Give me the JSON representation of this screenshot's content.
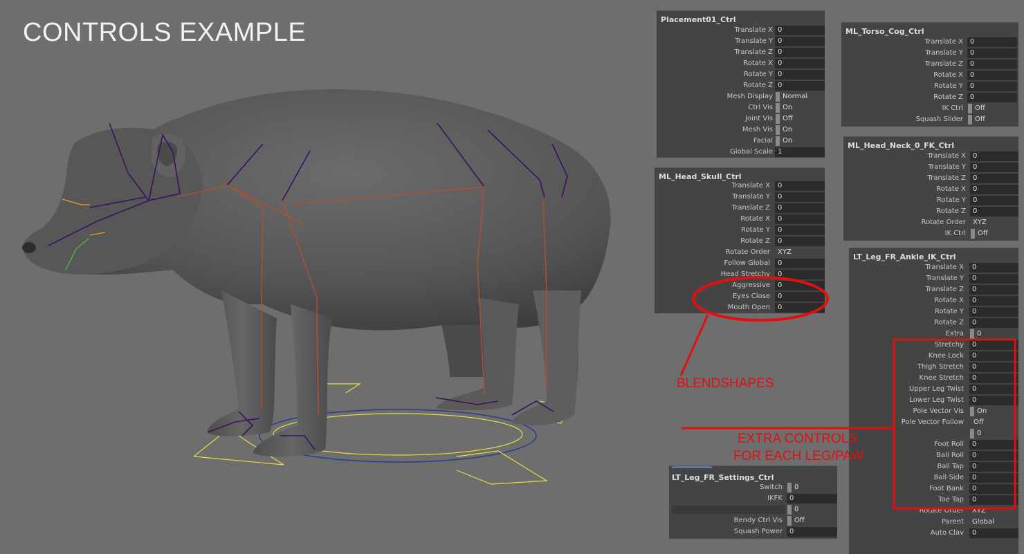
{
  "title": "CONTROLS EXAMPLE",
  "panels": {
    "placement": {
      "title": "Placement01_Ctrl",
      "rows": [
        {
          "label": "Translate X",
          "value": "0"
        },
        {
          "label": "Translate Y",
          "value": "0"
        },
        {
          "label": "Translate Z",
          "value": "0"
        },
        {
          "label": "Rotate X",
          "value": "0"
        },
        {
          "label": "Rotate Y",
          "value": "0"
        },
        {
          "label": "Rotate Z",
          "value": "0"
        },
        {
          "label": "Mesh Display",
          "value": "Normal"
        },
        {
          "label": "Ctrl Vis",
          "value": "On"
        },
        {
          "label": "Joint Vis",
          "value": "Off"
        },
        {
          "label": "Mesh Vis",
          "value": "On"
        },
        {
          "label": "Facial",
          "value": "On"
        },
        {
          "label": "Global Scale",
          "value": "1"
        }
      ]
    },
    "head_skull": {
      "title": "ML_Head_Skull_Ctrl",
      "rows": [
        {
          "label": "Translate X",
          "value": "0"
        },
        {
          "label": "Translate Y",
          "value": "0"
        },
        {
          "label": "Translate Z",
          "value": "0"
        },
        {
          "label": "Rotate X",
          "value": "0"
        },
        {
          "label": "Rotate Y",
          "value": "0"
        },
        {
          "label": "Rotate Z",
          "value": "0"
        },
        {
          "label": "Rotate Order",
          "value": "XYZ"
        },
        {
          "label": "Follow Global",
          "value": "0"
        },
        {
          "label": "Head Stretchy",
          "value": "0"
        },
        {
          "label": "Aggressive",
          "value": "0"
        },
        {
          "label": "Eyes Close",
          "value": "0"
        },
        {
          "label": "Mouth Open",
          "value": "0"
        }
      ]
    },
    "torso_cog": {
      "title": "ML_Torso_Cog_Ctrl",
      "rows": [
        {
          "label": "Translate X",
          "value": "0"
        },
        {
          "label": "Translate Y",
          "value": "0"
        },
        {
          "label": "Translate Z",
          "value": "0"
        },
        {
          "label": "Rotate X",
          "value": "0"
        },
        {
          "label": "Rotate Y",
          "value": "0"
        },
        {
          "label": "Rotate Z",
          "value": "0"
        },
        {
          "label": "IK Ctrl",
          "value": "Off"
        },
        {
          "label": "Squash Slider",
          "value": "Off"
        }
      ]
    },
    "head_neck": {
      "title": "ML_Head_Neck_0_FK_Ctrl",
      "rows": [
        {
          "label": "Translate X",
          "value": "0"
        },
        {
          "label": "Translate Y",
          "value": "0"
        },
        {
          "label": "Translate Z",
          "value": "0"
        },
        {
          "label": "Rotate X",
          "value": "0"
        },
        {
          "label": "Rotate Y",
          "value": "0"
        },
        {
          "label": "Rotate Z",
          "value": "0"
        },
        {
          "label": "Rotate Order",
          "value": "XYZ"
        },
        {
          "label": "IK Ctrl",
          "value": "Off"
        }
      ]
    },
    "ankle_ik": {
      "title": "LT_Leg_FR_Ankle_IK_Ctrl",
      "rows": [
        {
          "label": "Translate X",
          "value": "0"
        },
        {
          "label": "Translate Y",
          "value": "0"
        },
        {
          "label": "Translate Z",
          "value": "0"
        },
        {
          "label": "Rotate X",
          "value": "0"
        },
        {
          "label": "Rotate Y",
          "value": "0"
        },
        {
          "label": "Rotate Z",
          "value": "0"
        },
        {
          "label": "Extra",
          "value": "0"
        },
        {
          "label": "Stretchy",
          "value": "0"
        },
        {
          "label": "Knee Lock",
          "value": "0"
        },
        {
          "label": "Thigh Stretch",
          "value": "0"
        },
        {
          "label": "Knee Stretch",
          "value": "0"
        },
        {
          "label": "Upper Leg Twist",
          "value": "0"
        },
        {
          "label": "Lower Leg Twist",
          "value": "0"
        },
        {
          "label": "Pole Vector Vis",
          "value": "On"
        },
        {
          "label": "Pole Vector Follow",
          "value": "Off"
        },
        {
          "label": "",
          "value": "0"
        },
        {
          "label": "Foot Roll",
          "value": "0"
        },
        {
          "label": "Ball Roll",
          "value": "0"
        },
        {
          "label": "Ball Tap",
          "value": "0"
        },
        {
          "label": "Ball Side",
          "value": "0"
        },
        {
          "label": "Foot Bank",
          "value": "0"
        },
        {
          "label": "Toe Tap",
          "value": "0"
        },
        {
          "label": "Rotate Order",
          "value": "XYZ"
        },
        {
          "label": "Parent",
          "value": "Global"
        },
        {
          "label": "Auto Clav",
          "value": "0"
        }
      ]
    },
    "leg_settings": {
      "title": "LT_Leg_FR_Settings_Ctrl",
      "rows": [
        {
          "label": "Switch",
          "value": "0"
        },
        {
          "label": "IKFK",
          "value": "0"
        },
        {
          "label": "",
          "value": "0"
        },
        {
          "label": "Bendy Ctrl Vis",
          "value": "Off"
        },
        {
          "label": "Squash Power",
          "value": "0"
        }
      ]
    }
  },
  "annotations": {
    "blendshapes": "BLENDSHAPES",
    "extra_line1": "EXTRA CONTROLS",
    "extra_line2": "FOR EACH LEG/PAW"
  },
  "colors": {
    "background": "#6e6e6e",
    "panel": "#444444",
    "field": "#2b2b2b",
    "annotation": "#e01010",
    "bear": "#5c5c5c",
    "joint_purple": "#3a1060",
    "joint_orange": "#b4502a",
    "ctrl_yellow": "#e8e040",
    "ctrl_blue": "#2a3c8c"
  }
}
